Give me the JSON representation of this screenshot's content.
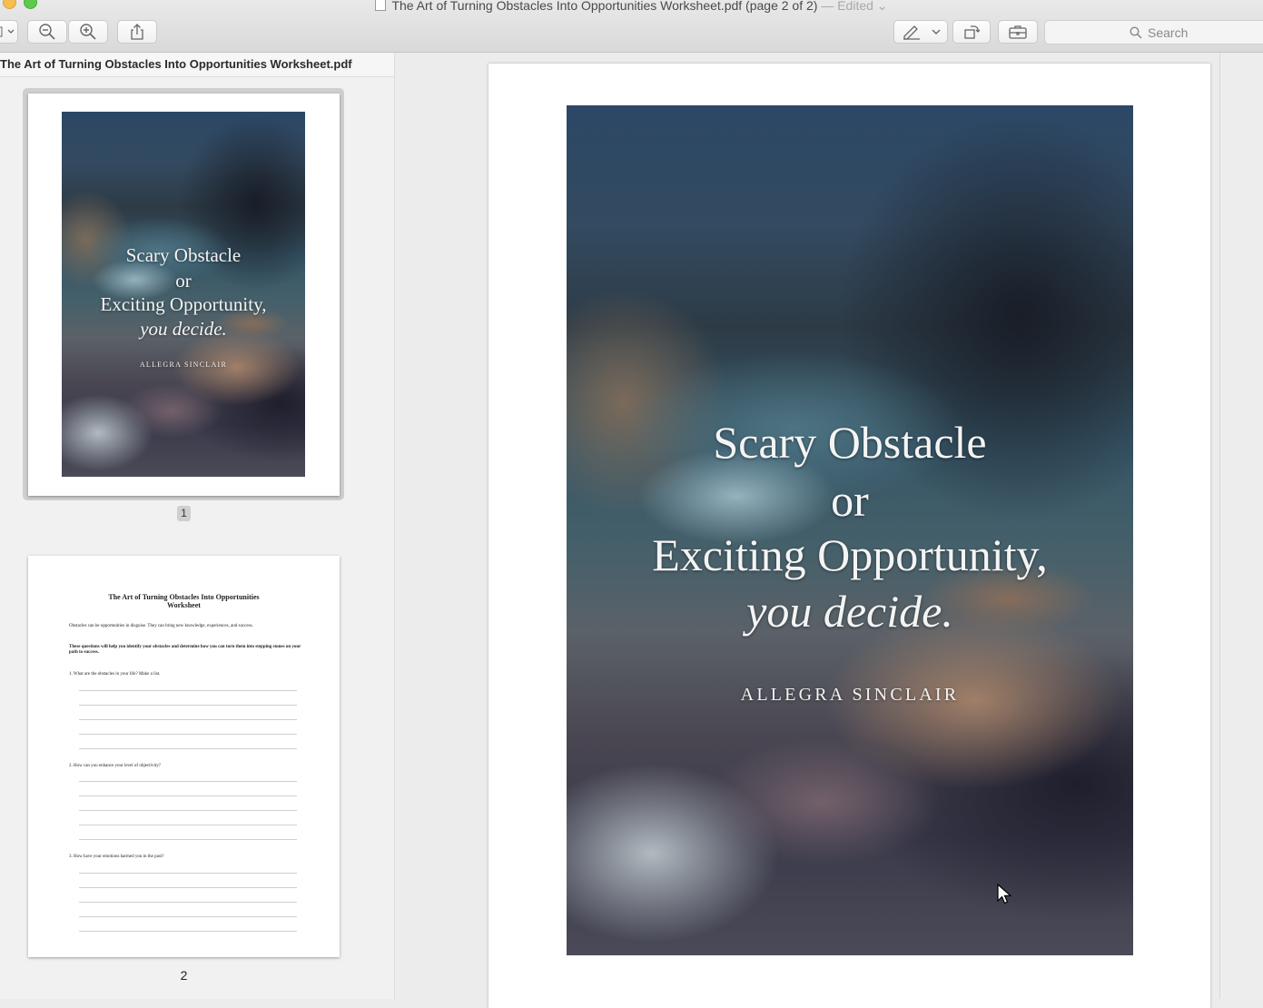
{
  "window": {
    "title": "The Art of Turning Obstacles Into Opportunities Worksheet.pdf (page 2 of 2)",
    "edited_label": "— Edited"
  },
  "toolbar": {
    "search_placeholder": "Search"
  },
  "sidebar": {
    "header": "The Art of Turning Obstacles Into Opportunities Worksheet.pdf",
    "pages": [
      {
        "number": "1",
        "selected": true
      },
      {
        "number": "2",
        "selected": false
      }
    ]
  },
  "cover": {
    "line1": "Scary Obstacle",
    "line2": "or",
    "line3": "Exciting Opportunity,",
    "line4": "you decide.",
    "author": "ALLEGRA SINCLAIR"
  },
  "worksheet": {
    "title_line1": "The Art of Turning Obstacles Into Opportunities",
    "title_line2": "Worksheet",
    "intro": "Obstacles can be opportunities in disguise. They can bring new knowledge, experiences, and success.",
    "instructions": "These questions will help you identify your obstacles and determine how you can turn them into stepping stones on your path to success.",
    "questions": [
      "1.   What are the obstacles in your life? Make a list.",
      "2.   How can you enhance your level of objectivity?",
      "3.   How have your emotions harmed you in the past?"
    ]
  }
}
